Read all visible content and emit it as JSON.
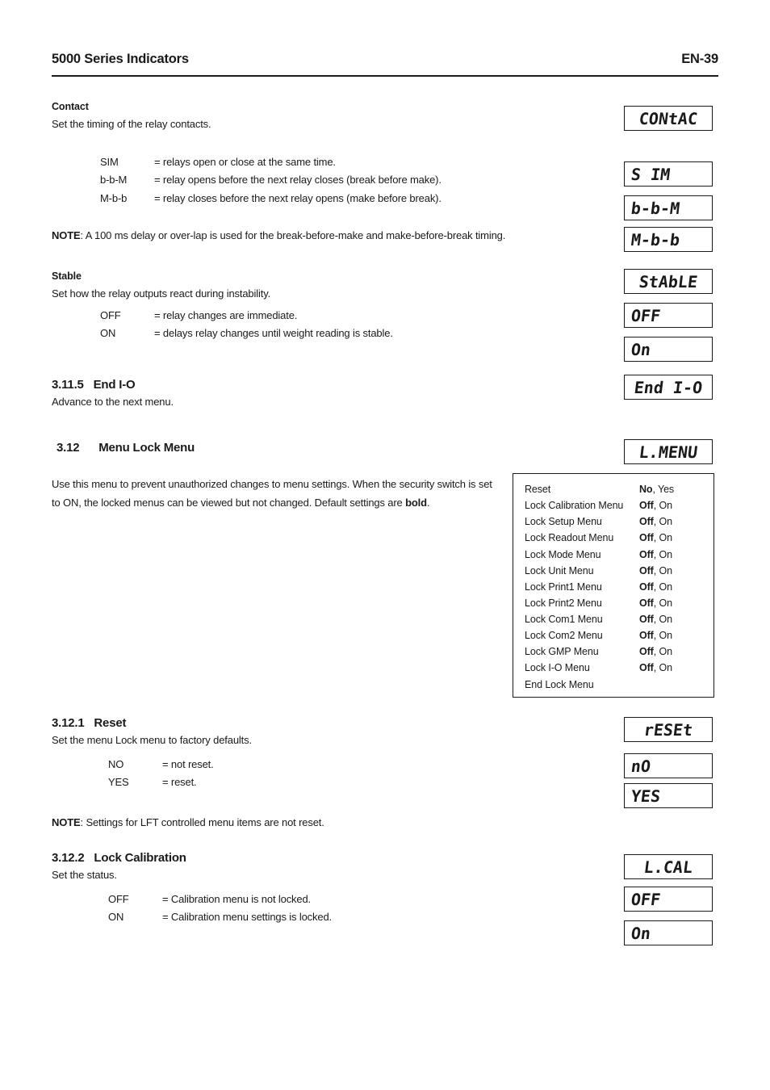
{
  "header": {
    "title": "5000 Series Indicators",
    "page": "EN-39"
  },
  "sections": {
    "contact": {
      "heading": "Contact",
      "intro": "Set the timing of the relay contacts.",
      "options": [
        {
          "term": "SIM",
          "desc": "= relays open or close at the same time."
        },
        {
          "term": "b-b-M",
          "desc": "= relay opens before the next relay closes (break before make)."
        },
        {
          "term": "M-b-b",
          "desc": "= relay closes before the next relay opens (make before break)."
        }
      ],
      "note_label": "NOTE",
      "note_text": ": A 100 ms delay or over-lap is used for the break-before-make and make-before-break timing."
    },
    "stable": {
      "heading": "Stable",
      "intro": "Set how the relay outputs react during instability.",
      "options": [
        {
          "term": "OFF",
          "desc": "= relay changes are immediate."
        },
        {
          "term": "ON",
          "desc": "= delays relay changes until weight reading is stable."
        }
      ]
    },
    "end_io": {
      "number": "3.11.5",
      "title": "End I-O",
      "body": "Advance to the next menu."
    },
    "menu_lock": {
      "number": "3.12",
      "title": "Menu Lock Menu",
      "body": "Use this menu to prevent unauthorized changes to menu settings.  When the security switch is set to ON, the locked menus can be viewed but not changed.  Default settings are ",
      "body_bold": "bold",
      "body_tail": "."
    },
    "reset": {
      "number": "3.12.1",
      "title": "Reset",
      "intro": "Set the menu Lock menu to factory defaults.",
      "options": [
        {
          "term": "NO",
          "desc": "= not reset."
        },
        {
          "term": "YES",
          "desc": "= reset."
        }
      ],
      "note_label": "NOTE",
      "note_text": ": Settings for LFT controlled menu items are not reset."
    },
    "lock_calibration": {
      "number": "3.12.2",
      "title": "Lock Calibration",
      "intro": "Set the status.",
      "options": [
        {
          "term": "OFF",
          "desc": "= Calibration menu is not locked."
        },
        {
          "term": "ON",
          "desc": "= Calibration menu settings is locked."
        }
      ]
    }
  },
  "lock_table": {
    "rows": [
      {
        "label": "Reset",
        "default": "No",
        "rest": ", Yes"
      },
      {
        "label": "Lock Calibration Menu",
        "default": "Off",
        "rest": ", On"
      },
      {
        "label": "Lock Setup Menu",
        "default": "Off",
        "rest": ", On"
      },
      {
        "label": "Lock Readout Menu",
        "default": "Off",
        "rest": ", On"
      },
      {
        "label": "Lock Mode Menu",
        "default": "Off",
        "rest": ", On"
      },
      {
        "label": "Lock Unit Menu",
        "default": "Off",
        "rest": ", On"
      },
      {
        "label": "Lock Print1 Menu",
        "default": "Off",
        "rest": ", On"
      },
      {
        "label": "Lock Print2 Menu",
        "default": "Off",
        "rest": ", On"
      },
      {
        "label": "Lock Com1 Menu",
        "default": "Off",
        "rest": ", On"
      },
      {
        "label": "Lock Com2 Menu",
        "default": "Off",
        "rest": ", On"
      },
      {
        "label": "Lock GMP Menu",
        "default": "Off",
        "rest": ", On"
      },
      {
        "label": "Lock I-O Menu",
        "default": "Off",
        "rest": ", On"
      },
      {
        "label": "End Lock Menu",
        "default": "",
        "rest": ""
      }
    ]
  },
  "displays": {
    "contac": "CONtAC",
    "sim": "S IM",
    "bbm": "b-b-M",
    "mbb": "M-b-b",
    "stable": "StAbLE",
    "off1": "OFF",
    "on1": "On",
    "end_io": "End I-O",
    "lmenu": "L.MENU",
    "reset": "rESEt",
    "no": "nO",
    "yes": "YES",
    "lcal": "L.CAL",
    "off2": "OFF",
    "on2": "On"
  }
}
